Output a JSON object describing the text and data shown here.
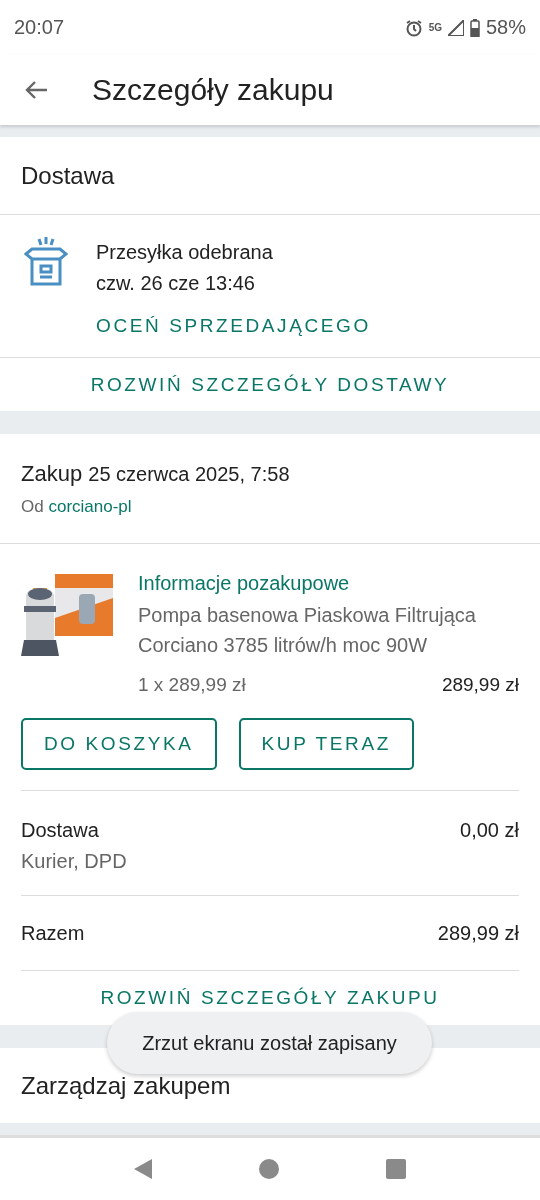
{
  "status_bar": {
    "time": "20:07",
    "network": "5G",
    "battery": "58%"
  },
  "app_bar": {
    "title": "Szczegóły zakupu"
  },
  "delivery": {
    "heading": "Dostawa",
    "status": "Przesyłka odebrana",
    "date": "czw. 26 cze 13:46",
    "rate_link": "OCEŃ SPRZEDAJĄCEGO",
    "expand_link": "ROZWIŃ SZCZEGÓŁY DOSTAWY"
  },
  "purchase": {
    "label": "Zakup",
    "date": "25 czerwca 2025, 7:58",
    "seller_prefix": "Od",
    "seller": "corciano-pl",
    "item": {
      "kind": "picture",
      "info_link": "Informacje pozakupowe",
      "title": "Pompa basenowa Piaskowa Filtrująca Corciano 3785 litrów/h moc 90W",
      "quantity_price": "1 x 289,99 zł",
      "total": "289,99 zł"
    },
    "buttons": [
      "DO KOSZYKA",
      "KUP TERAZ"
    ],
    "shipping": {
      "label": "Dostawa",
      "method": "Kurier, DPD",
      "price": "0,00 zł"
    },
    "sum": {
      "label": "Razem",
      "price": "289,99 zł"
    },
    "expand_link": "ROZWIŃ SZCZEGÓŁY ZAKUPU"
  },
  "manage": {
    "heading": "Zarządzaj zakupem"
  },
  "toast": "Zrzut ekranu został zapisany"
}
